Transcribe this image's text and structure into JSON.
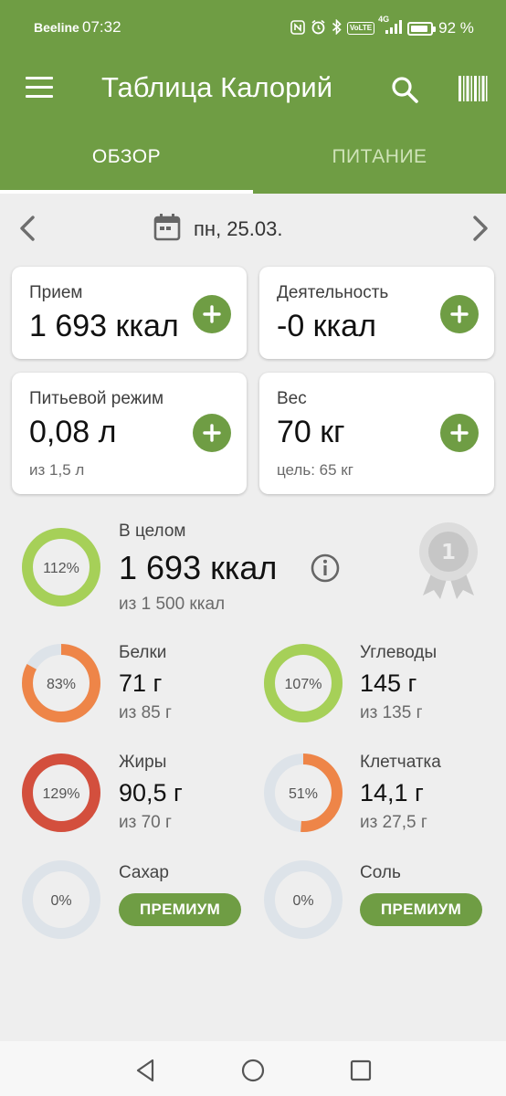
{
  "status_bar": {
    "carrier": "Beeline",
    "time": "07:32",
    "network": "4G",
    "battery_percent": "92 %",
    "battery_level": 0.92
  },
  "toolbar": {
    "title": "Таблица Калорий",
    "menu_icon": "menu-icon",
    "search_icon": "search-icon",
    "barcode_icon": "barcode-icon"
  },
  "tabs": [
    {
      "label": "ОБЗОР",
      "active": true
    },
    {
      "label": "ПИТАНИЕ",
      "active": false
    }
  ],
  "date_nav": {
    "date": "пн, 25.03."
  },
  "cards": {
    "intake": {
      "label": "Прием",
      "value": "1 693 ккал"
    },
    "activity": {
      "label": "Деятельность",
      "value": "-0 ккал"
    },
    "water": {
      "label": "Питьевой режим",
      "value": "0,08 л",
      "sub": "из 1,5 л"
    },
    "weight": {
      "label": "Вес",
      "value": "70 кг",
      "sub": "цель: 65 кг"
    }
  },
  "summary": {
    "percent": "112%",
    "progress": 1.12,
    "label": "В целом",
    "value": "1 693 ккал",
    "sub": "из 1 500 ккал",
    "badge_number": "1"
  },
  "nutrients": {
    "protein": {
      "label": "Белки",
      "value": "71 г",
      "sub": "из 85 г",
      "percent": "83%",
      "progress": 0.83
    },
    "carbs": {
      "label": "Углеводы",
      "value": "145 г",
      "sub": "из 135 г",
      "percent": "107%",
      "progress": 1.07
    },
    "fat": {
      "label": "Жиры",
      "value": "90,5 г",
      "sub": "из 70 г",
      "percent": "129%",
      "progress": 1.29
    },
    "fiber": {
      "label": "Клетчатка",
      "value": "14,1 г",
      "sub": "из 27,5 г",
      "percent": "51%",
      "progress": 0.51
    },
    "sugar": {
      "label": "Сахар",
      "percent": "0%",
      "progress": 0,
      "button": "ПРЕМИУМ"
    },
    "salt": {
      "label": "Соль",
      "percent": "0%",
      "progress": 0,
      "button": "ПРЕМИУМ"
    }
  },
  "colors": {
    "brand_green": "#6f9d44",
    "ring_over_green": "#a6d058",
    "ring_orange": "#ee8548",
    "ring_red": "#d34f3d",
    "ring_track": "#dde3e9"
  }
}
